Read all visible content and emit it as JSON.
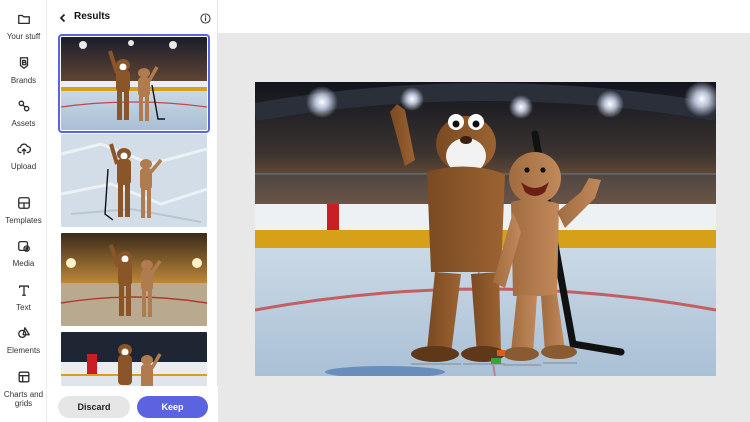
{
  "rail": {
    "items": [
      {
        "label": "Your stuff",
        "icon": "folder-icon"
      },
      {
        "label": "Brands",
        "icon": "brand-icon"
      },
      {
        "label": "Assets",
        "icon": "shapes-icon"
      },
      {
        "label": "Upload",
        "icon": "upload-icon"
      },
      {
        "label": "Templates",
        "icon": "templates-icon"
      },
      {
        "label": "Media",
        "icon": "media-icon"
      },
      {
        "label": "Text",
        "icon": "text-icon"
      },
      {
        "label": "Elements",
        "icon": "elements-icon"
      },
      {
        "label": "Charts and grids",
        "icon": "charts-grids-icon"
      }
    ]
  },
  "panel": {
    "title": "Results",
    "back_icon": "chevron-left-icon",
    "info_icon": "info-icon",
    "results": [
      {
        "variant": "arena-night",
        "selected": true
      },
      {
        "variant": "ice-closeup",
        "selected": false
      },
      {
        "variant": "arena-golden",
        "selected": false
      },
      {
        "variant": "arena-day",
        "selected": false
      }
    ],
    "discard_label": "Discard",
    "keep_label": "Keep"
  },
  "colors": {
    "accent": "#5b63e0",
    "canvas_bg": "#e8e8e8",
    "discard_bg": "#e6e6e6"
  }
}
